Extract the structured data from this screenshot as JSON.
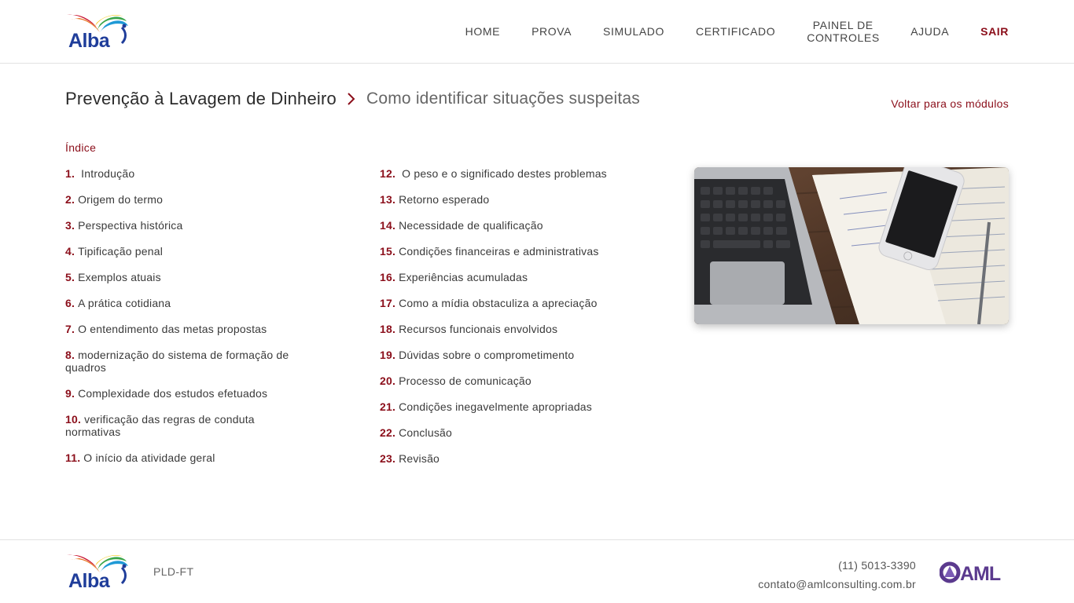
{
  "header": {
    "logo_text": "Alba",
    "nav": [
      "HOME",
      "PROVA",
      "SIMULADO",
      "CERTIFICADO",
      "PAINEL DE CONTROLES",
      "AJUDA",
      "SAIR"
    ]
  },
  "breadcrumb": {
    "course": "Prevenção à Lavagem de Dinheiro",
    "module": "Como identificar situações suspeitas",
    "back_label": "Voltar para os módulos"
  },
  "index": {
    "title": "Índice",
    "column1": [
      {
        "num": "1.",
        "label": " Introdução"
      },
      {
        "num": "2.",
        "label": "Origem do termo"
      },
      {
        "num": "3.",
        "label": "Perspectiva histórica"
      },
      {
        "num": "4.",
        "label": "Tipificação penal"
      },
      {
        "num": "5.",
        "label": "Exemplos atuais"
      },
      {
        "num": "6.",
        "label": "A prática cotidiana"
      },
      {
        "num": "7.",
        "label": "O entendimento das metas propostas"
      },
      {
        "num": "8.",
        "label": "modernização do sistema de formação de quadros"
      },
      {
        "num": "9.",
        "label": "Complexidade dos estudos efetuados"
      },
      {
        "num": "10.",
        "label": "verificação das regras de conduta normativas"
      },
      {
        "num": "11.",
        "label": "O início da atividade geral"
      }
    ],
    "column2": [
      {
        "num": "12.",
        "label": " O peso e o significado destes problemas"
      },
      {
        "num": "13.",
        "label": "Retorno esperado"
      },
      {
        "num": "14.",
        "label": "Necessidade de qualificação"
      },
      {
        "num": "15.",
        "label": "Condições financeiras e administrativas"
      },
      {
        "num": "16.",
        "label": "Experiências acumuladas"
      },
      {
        "num": "17.",
        "label": "Como a mídia obstaculiza a apreciação"
      },
      {
        "num": "18.",
        "label": "Recursos funcionais envolvidos"
      },
      {
        "num": "19.",
        "label": "Dúvidas sobre o comprometimento"
      },
      {
        "num": "20.",
        "label": "Processo de comunicação"
      },
      {
        "num": "21.",
        "label": "Condições inegavelmente apropriadas"
      },
      {
        "num": "22.",
        "label": "Conclusão"
      },
      {
        "num": "23.",
        "label": "Revisão"
      }
    ]
  },
  "footer": {
    "logo_text": "Alba",
    "label": "PLD-FT",
    "phone": "(11) 5013-3390",
    "email": "contato@amlconsulting.com.br",
    "aml_logo_text": "AML"
  },
  "colors": {
    "accent": "#8b0e1a",
    "brand_blue": "#1f3d9a",
    "aml_purple": "#5b3a8e"
  }
}
